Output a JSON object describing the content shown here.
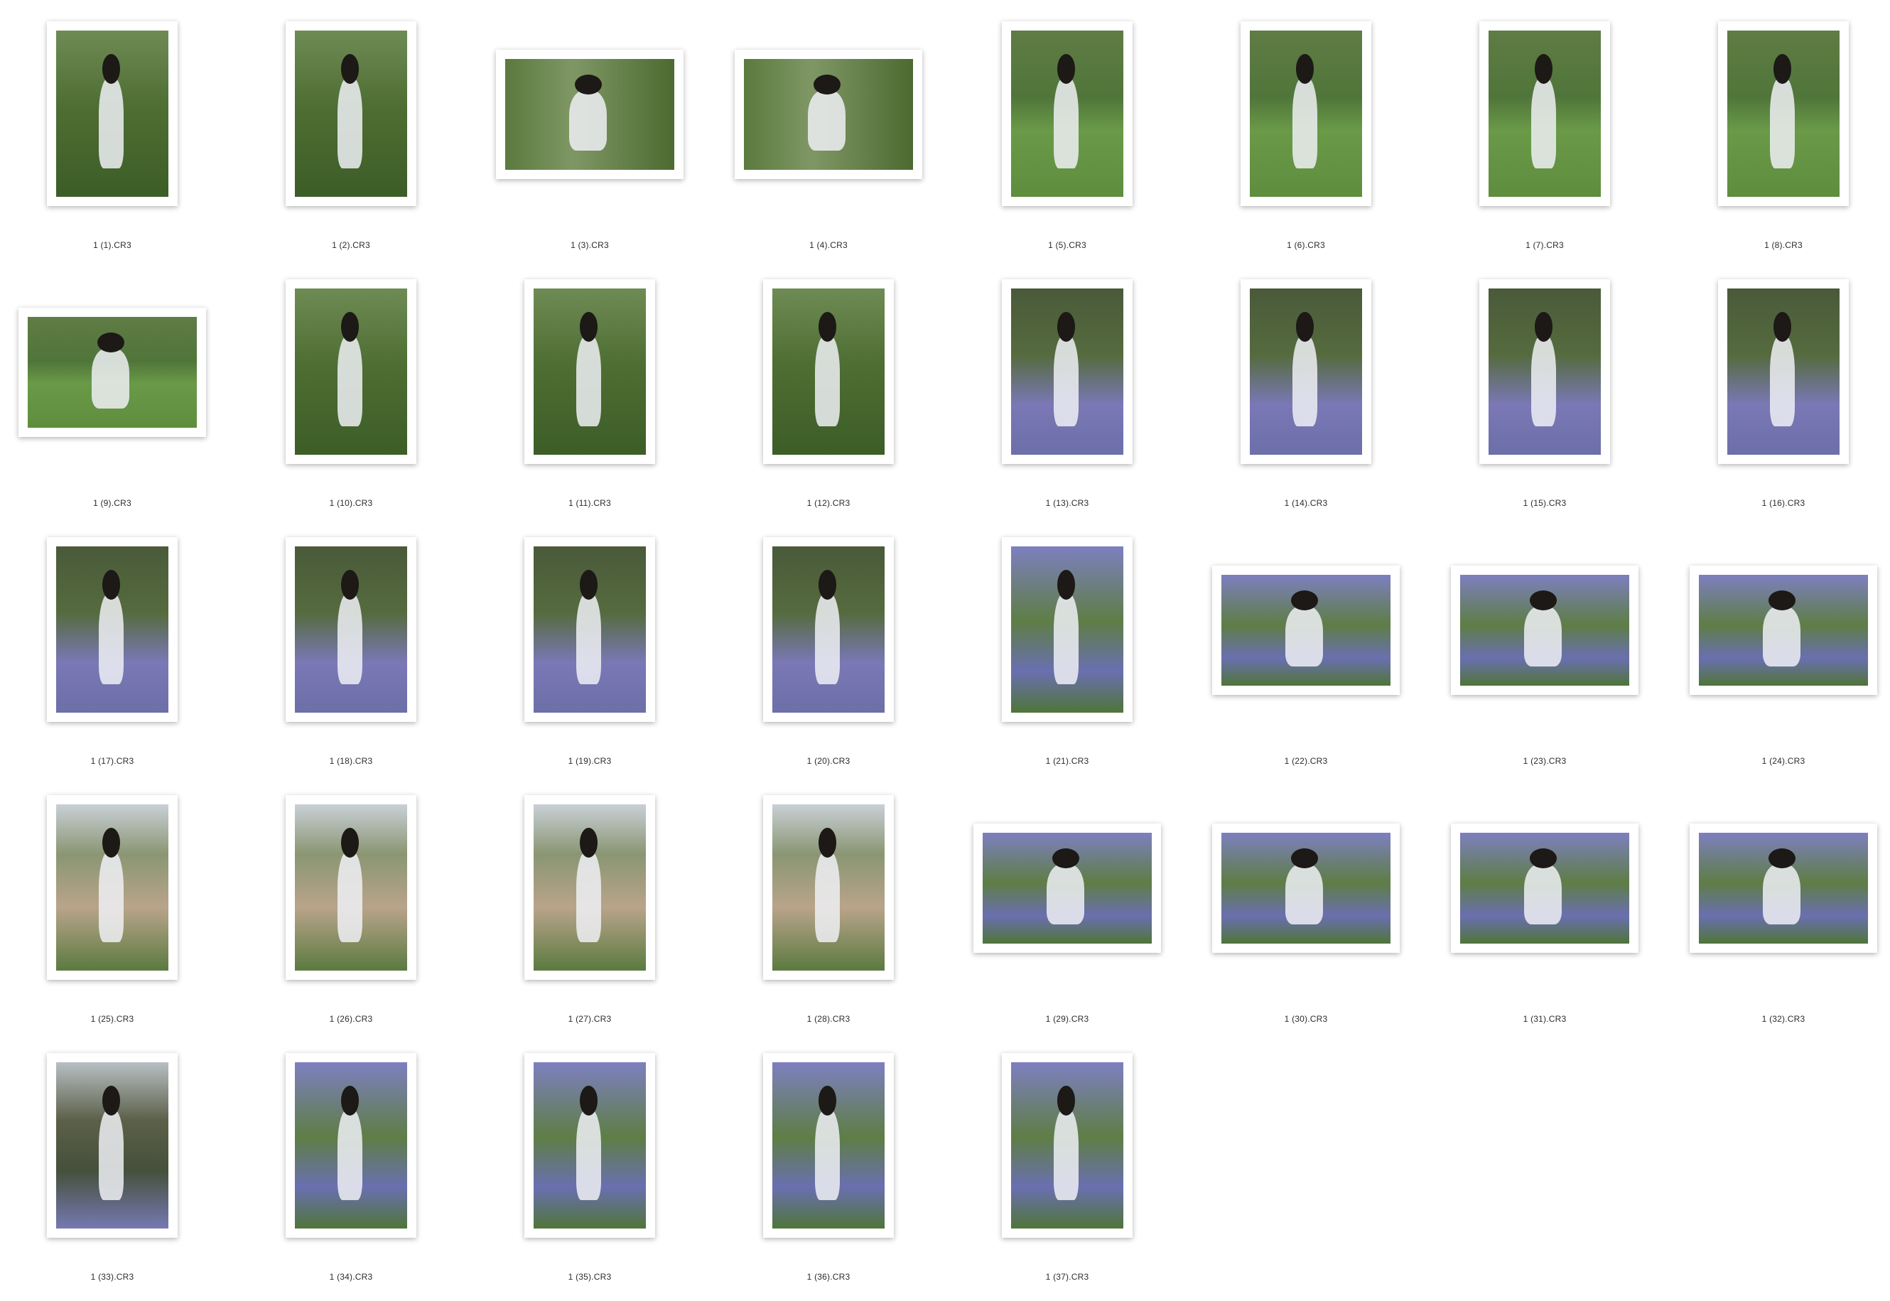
{
  "files": [
    {
      "name": "1 (1).CR3",
      "orientation": "portrait",
      "scene": "grass"
    },
    {
      "name": "1 (2).CR3",
      "orientation": "portrait",
      "scene": "grass"
    },
    {
      "name": "1 (3).CR3",
      "orientation": "landscape",
      "scene": "grass-closeup"
    },
    {
      "name": "1 (4).CR3",
      "orientation": "landscape",
      "scene": "grass-closeup"
    },
    {
      "name": "1 (5).CR3",
      "orientation": "portrait",
      "scene": "grass-lawn"
    },
    {
      "name": "1 (6).CR3",
      "orientation": "portrait",
      "scene": "grass-lawn"
    },
    {
      "name": "1 (7).CR3",
      "orientation": "portrait",
      "scene": "grass-lawn"
    },
    {
      "name": "1 (8).CR3",
      "orientation": "portrait",
      "scene": "grass-lawn"
    },
    {
      "name": "1 (9).CR3",
      "orientation": "landscape",
      "scene": "grass-lawn"
    },
    {
      "name": "1 (10).CR3",
      "orientation": "portrait",
      "scene": "grass"
    },
    {
      "name": "1 (11).CR3",
      "orientation": "portrait",
      "scene": "grass"
    },
    {
      "name": "1 (12).CR3",
      "orientation": "portrait",
      "scene": "grass"
    },
    {
      "name": "1 (13).CR3",
      "orientation": "portrait",
      "scene": "forest-flowers"
    },
    {
      "name": "1 (14).CR3",
      "orientation": "portrait",
      "scene": "forest-flowers"
    },
    {
      "name": "1 (15).CR3",
      "orientation": "portrait",
      "scene": "forest-flowers"
    },
    {
      "name": "1 (16).CR3",
      "orientation": "portrait",
      "scene": "forest-flowers"
    },
    {
      "name": "1 (17).CR3",
      "orientation": "portrait",
      "scene": "forest-flowers"
    },
    {
      "name": "1 (18).CR3",
      "orientation": "portrait",
      "scene": "forest-flowers"
    },
    {
      "name": "1 (19).CR3",
      "orientation": "portrait",
      "scene": "forest-flowers"
    },
    {
      "name": "1 (20).CR3",
      "orientation": "portrait",
      "scene": "forest-flowers"
    },
    {
      "name": "1 (21).CR3",
      "orientation": "portrait",
      "scene": "flowers"
    },
    {
      "name": "1 (22).CR3",
      "orientation": "landscape",
      "scene": "flowers"
    },
    {
      "name": "1 (23).CR3",
      "orientation": "landscape",
      "scene": "flowers"
    },
    {
      "name": "1 (24).CR3",
      "orientation": "landscape",
      "scene": "flowers"
    },
    {
      "name": "1 (25).CR3",
      "orientation": "portrait",
      "scene": "boardwalk"
    },
    {
      "name": "1 (26).CR3",
      "orientation": "portrait",
      "scene": "boardwalk"
    },
    {
      "name": "1 (27).CR3",
      "orientation": "portrait",
      "scene": "boardwalk"
    },
    {
      "name": "1 (28).CR3",
      "orientation": "portrait",
      "scene": "boardwalk"
    },
    {
      "name": "1 (29).CR3",
      "orientation": "landscape",
      "scene": "flowers"
    },
    {
      "name": "1 (30).CR3",
      "orientation": "landscape",
      "scene": "flowers"
    },
    {
      "name": "1 (31).CR3",
      "orientation": "landscape",
      "scene": "flowers"
    },
    {
      "name": "1 (32).CR3",
      "orientation": "landscape",
      "scene": "flowers"
    },
    {
      "name": "1 (33).CR3",
      "orientation": "portrait",
      "scene": "forest"
    },
    {
      "name": "1 (34).CR3",
      "orientation": "portrait",
      "scene": "flowers"
    },
    {
      "name": "1 (35).CR3",
      "orientation": "portrait",
      "scene": "flowers"
    },
    {
      "name": "1 (36).CR3",
      "orientation": "portrait",
      "scene": "flowers"
    },
    {
      "name": "1 (37).CR3",
      "orientation": "portrait",
      "scene": "flowers"
    }
  ]
}
